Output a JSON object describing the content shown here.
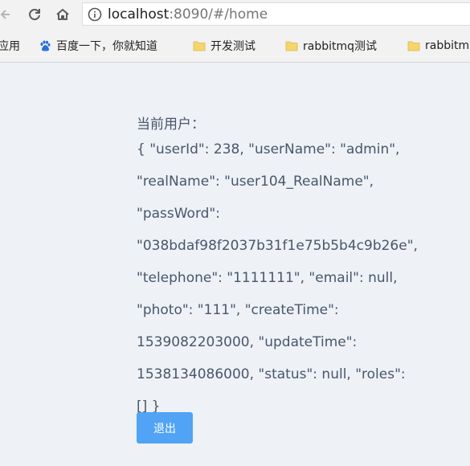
{
  "browser": {
    "url_host": "localhost",
    "url_rest": ":8090/#/home"
  },
  "bookmarks": {
    "apps_label": "应用",
    "items": [
      {
        "label": "百度一下，你就知道",
        "icon": "baidu-icon"
      },
      {
        "label": "开发测试",
        "icon": "folder-icon"
      },
      {
        "label": "rabbitmq测试",
        "icon": "folder-icon"
      },
      {
        "label": "rabbitm",
        "icon": "folder-icon"
      }
    ]
  },
  "main": {
    "user_title": "当前用户：",
    "user_lines": [
      "{ \"userId\": 238, \"userName\": \"admin\",",
      "\"realName\": \"user104_RealName\",",
      "\"passWord\":",
      "\"038bdaf98f2037b31f1e75b5b4c9b26e\",",
      "\"telephone\": \"1111111\", \"email\": null,",
      "\"photo\": \"111\", \"createTime\":",
      "1539082203000, \"updateTime\":",
      "1538134086000, \"status\": null, \"roles\": [] }"
    ],
    "logout_label": "退出"
  },
  "colors": {
    "page_bg": "#eef1f6",
    "text": "#48576a",
    "button_bg": "#50a3f5"
  }
}
